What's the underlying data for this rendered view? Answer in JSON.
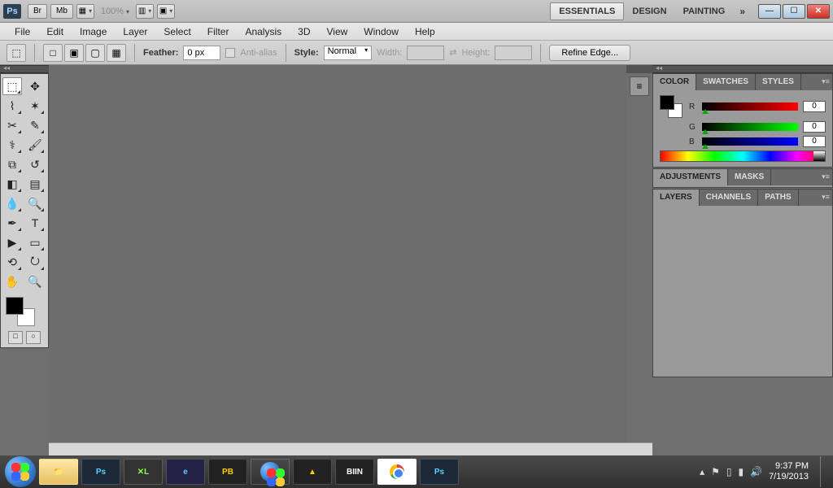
{
  "title": {
    "app": "Ps",
    "br": "Br",
    "mb": "Mb",
    "zoom": "100%"
  },
  "workspaces": {
    "essentials": "ESSENTIALS",
    "design": "DESIGN",
    "painting": "PAINTING"
  },
  "menu": [
    "File",
    "Edit",
    "Image",
    "Layer",
    "Select",
    "Filter",
    "Analysis",
    "3D",
    "View",
    "Window",
    "Help"
  ],
  "options": {
    "feather_label": "Feather:",
    "feather_value": "0 px",
    "antialias": "Anti-alias",
    "style_label": "Style:",
    "style_value": "Normal",
    "width_label": "Width:",
    "height_label": "Height:",
    "refine": "Refine Edge..."
  },
  "tools": [
    "marquee",
    "move",
    "lasso",
    "quick-select",
    "crop",
    "eyedropper",
    "healing",
    "brush",
    "stamp",
    "history-brush",
    "eraser",
    "gradient",
    "blur",
    "dodge",
    "pen",
    "type",
    "path-select",
    "shape",
    "3d-rotate",
    "3d-orbit",
    "hand",
    "zoom"
  ],
  "panels": {
    "color": {
      "tab": "COLOR",
      "swatches": "SWATCHES",
      "styles": "STYLES",
      "r_label": "R",
      "g_label": "G",
      "b_label": "B",
      "r": "0",
      "g": "0",
      "b": "0"
    },
    "adjustments": {
      "tab": "ADJUSTMENTS",
      "masks": "MASKS"
    },
    "layers": {
      "tab": "LAYERS",
      "channels": "CHANNELS",
      "paths": "PATHS"
    }
  },
  "taskbar": {
    "items": [
      "explorer",
      "photoshop",
      "xl",
      "ie",
      "pb",
      "mediacenter",
      "aimp",
      "biin",
      "chrome",
      "photoshop2"
    ],
    "biin": "BIIN",
    "time": "9:37 PM",
    "date": "7/19/2013"
  }
}
